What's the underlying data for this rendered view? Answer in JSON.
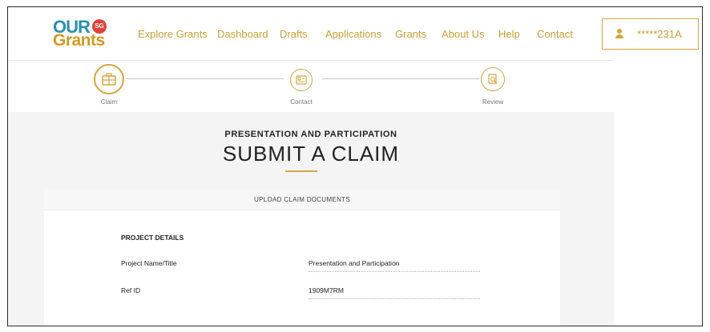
{
  "logo": {
    "line1": "OUR",
    "badge": "SG",
    "line2": "Grants"
  },
  "nav": {
    "items": [
      {
        "label": "Explore Grants"
      },
      {
        "label": "Dashboard"
      },
      {
        "label": "Drafts"
      },
      {
        "label": "Applications"
      },
      {
        "label": "Grants"
      },
      {
        "label": "About Us"
      },
      {
        "label": "Help"
      },
      {
        "label": "Contact"
      }
    ]
  },
  "user": {
    "id": "*****231A",
    "icon": "user-icon"
  },
  "stepper": {
    "steps": [
      {
        "label": "Claim",
        "icon": "briefcase-icon",
        "state": "current"
      },
      {
        "label": "Contact",
        "icon": "contact-card-icon",
        "state": "upcoming"
      },
      {
        "label": "Review",
        "icon": "document-review-icon",
        "state": "upcoming"
      }
    ]
  },
  "page": {
    "subtitle": "PRESENTATION AND PARTICIPATION",
    "title": "SUBMIT A CLAIM"
  },
  "card": {
    "header": "UPLOAD CLAIM DOCUMENTS",
    "section_title": "PROJECT DETAILS",
    "fields": [
      {
        "label": "Project Name/Title",
        "value": "Presentation and Participation"
      },
      {
        "label": "Ref ID",
        "value": "1909M7RM"
      }
    ]
  },
  "colors": {
    "accent": "#d4a540",
    "nav_text": "#c9a034",
    "logo_blue": "#2c8fb0",
    "logo_red": "#e0433a"
  }
}
